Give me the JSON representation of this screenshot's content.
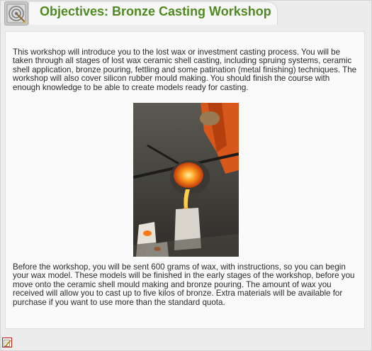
{
  "header": {
    "title": "Objectives: Bronze Casting Workshop",
    "icon": "target-icon"
  },
  "main": {
    "intro": "This workshop will introduce you to the lost wax or investment casting process. You will be taken through all stages of lost wax ceramic shell casting, including spruing systems, ceramic shell application, bronze pouring, fettling and some patination (metal finishing) techniques. The workshop will also cover silicon rubber mould making. You should finish the course with enough knowledge to be able to create models ready for casting.",
    "details": "Before the workshop, you will be sent 600 grams of wax, with instructions, so you can begin your wax model. These models will be finished in the early stages of the workshop, before you move onto the ceramic shell mould making and bronze pouring. The amount of wax you received will allow you to cast up to five kilos of bronze. Extra materials will be available for purchase if you want to use more than the standard quota.",
    "photo_icon": "bronze-pouring-photo"
  },
  "footer": {
    "edit_icon": "edit-icon"
  },
  "colors": {
    "title": "#4e8a1f",
    "edit_border": "#c01818"
  }
}
